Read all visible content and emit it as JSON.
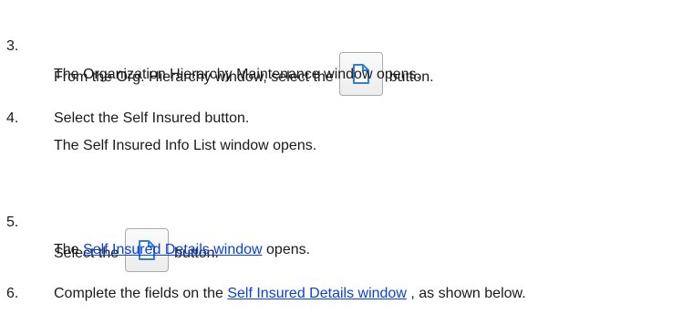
{
  "steps": [
    {
      "number": "3.",
      "line1_before": "From the Org. Hierarchy window, select the",
      "line1_after": "button.",
      "line2": "The Organization Hierarchy Maintenance window opens."
    },
    {
      "number": "4.",
      "line1": "Select the Self Insured button.",
      "line2": "The Self Insured Info List window opens."
    },
    {
      "number": "5.",
      "line1_before": "Select the",
      "line1_after": "button.",
      "line2_before": "The",
      "line2_link": "Self Insured Details window",
      "line2_after": "opens."
    },
    {
      "number": "6.",
      "line1_before": "Complete the fields on the",
      "line1_link": "Self Insured Details window",
      "line1_after": ", as shown below."
    }
  ],
  "icons": {
    "new_button_icon": "new-document-icon"
  },
  "colors": {
    "link": "#0a3fd8",
    "icon_accent": "#2f7fd9"
  }
}
